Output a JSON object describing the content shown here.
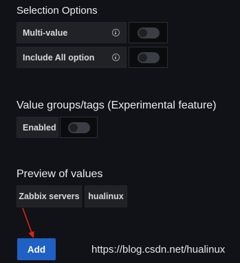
{
  "selection_options": {
    "title": "Selection Options",
    "multi_value": {
      "label": "Multi-value",
      "enabled": false
    },
    "include_all": {
      "label": "Include All option",
      "enabled": false
    }
  },
  "value_groups": {
    "title": "Value groups/tags (Experimental feature)",
    "enabled_label": "Enabled",
    "enabled": false
  },
  "preview": {
    "title": "Preview of values",
    "values": [
      "Zabbix servers",
      "hualinux"
    ]
  },
  "actions": {
    "add_label": "Add"
  },
  "watermark": "https://blog.csdn.net/hualinux",
  "colors": {
    "background": "#111217",
    "primary_button": "#1f60c4",
    "annotation_arrow": "#e0201b"
  }
}
